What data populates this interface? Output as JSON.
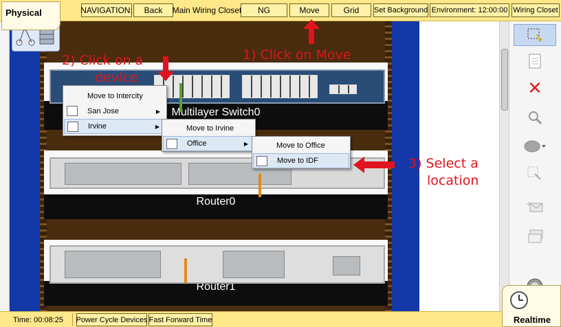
{
  "mode_tab": {
    "label": "Physical"
  },
  "toolbar_top": {
    "navigation_label": "NAVIGATION:",
    "back": "Back",
    "location": "Main Wiring Closet",
    "ng": "NG",
    "move": "Move",
    "grid": "Grid",
    "set_background": "Set Background",
    "environment": "Environment: 12:00:00",
    "wiring_closet": "Wiring Closet"
  },
  "devices": {
    "switch_label": "Multilayer Switch0",
    "router0_label": "Router0",
    "router1_label": "Router1"
  },
  "menus": {
    "level1": [
      "Move to Intercity",
      "San Jose",
      "Irvine"
    ],
    "level2": [
      "Move to Irvine",
      "Office"
    ],
    "level3": [
      "Move to Office",
      "Move to IDF"
    ]
  },
  "annotations": {
    "step1": "1) Click on Move",
    "step2_line1": "2) Click on a",
    "step2_line2": "device",
    "step3_line1": "3) Select a",
    "step3_line2": "location"
  },
  "bottom": {
    "time": "Time: 00:08:25",
    "power_cycle": "Power Cycle Devices",
    "fast_forward": "Fast Forward Time",
    "realtime": "Realtime"
  },
  "colors": {
    "accent_bar": "#ffe88a",
    "annotation": "#e0141e",
    "canvas": "#1338a8"
  }
}
